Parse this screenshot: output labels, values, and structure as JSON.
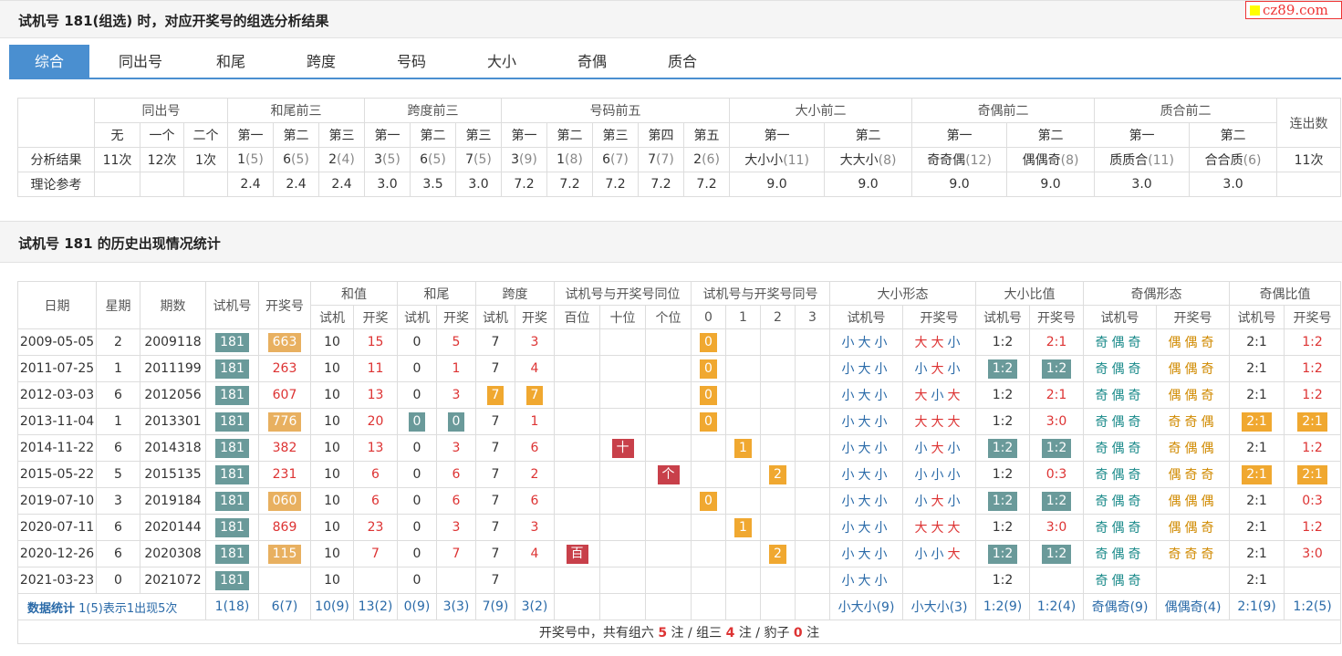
{
  "section1_title": "试机号 181(组选) 时，对应开奖号的组选分析结果",
  "logo_text": "cz89.com",
  "tabs": [
    "综合",
    "同出号",
    "和尾",
    "跨度",
    "号码",
    "大小",
    "奇偶",
    "质合"
  ],
  "t1": {
    "groups": [
      "同出号",
      "和尾前三",
      "跨度前三",
      "号码前五",
      "大小前二",
      "奇偶前二",
      "质合前二",
      "连出数"
    ],
    "subs": [
      "无",
      "一个",
      "二个",
      "第一",
      "第二",
      "第三",
      "第一",
      "第二",
      "第三",
      "第一",
      "第二",
      "第三",
      "第四",
      "第五",
      "第一",
      "第二",
      "第一",
      "第二",
      "第一",
      "第二"
    ],
    "row_analysis_label": "分析结果",
    "row_ref_label": "理论参考",
    "analysis": [
      "11次",
      "12次",
      "1次",
      "1(5)",
      "6(5)",
      "2(4)",
      "3(5)",
      "6(5)",
      "7(5)",
      "3(9)",
      "1(8)",
      "6(7)",
      "7(7)",
      "2(6)",
      "大小小(11)",
      "大大小(8)",
      "奇奇偶(12)",
      "偶偶奇(8)",
      "质质合(11)",
      "合合质(6)",
      "11次"
    ],
    "ref": [
      "",
      "",
      "",
      "2.4",
      "2.4",
      "2.4",
      "3.0",
      "3.5",
      "3.0",
      "7.2",
      "7.2",
      "7.2",
      "7.2",
      "7.2",
      "9.0",
      "9.0",
      "9.0",
      "9.0",
      "3.0",
      "3.0",
      ""
    ]
  },
  "section2_title": "试机号 181 的历史出现情况统计",
  "t2": {
    "h_single": [
      "日期",
      "星期",
      "期数",
      "试机号",
      "开奖号"
    ],
    "h_groups": [
      "和值",
      "和尾",
      "跨度",
      "试机号与开奖号同位",
      "试机号与开奖号同号",
      "大小形态",
      "大小比值",
      "奇偶形态",
      "奇偶比值"
    ],
    "h_subs": [
      "试机",
      "开奖",
      "试机",
      "开奖",
      "试机",
      "开奖",
      "百位",
      "十位",
      "个位",
      "0",
      "1",
      "2",
      "3",
      "试机号",
      "开奖号",
      "试机号",
      "开奖号",
      "试机号",
      "开奖号",
      "试机号",
      "开奖号"
    ],
    "rows": [
      [
        "2009-05-05",
        "2",
        "2009118",
        "181",
        "663",
        "10",
        "15",
        "0",
        "5",
        "7",
        "3",
        "",
        "",
        "",
        "0",
        "",
        "",
        "",
        "小大小",
        "大大小",
        "1:2",
        "2:1",
        "奇偶奇",
        "偶偶奇",
        "2:1",
        "1:2"
      ],
      [
        "2011-07-25",
        "1",
        "2011199",
        "181",
        "263",
        "10",
        "11",
        "0",
        "1",
        "7",
        "4",
        "",
        "",
        "",
        "0",
        "",
        "",
        "",
        "小大小",
        "小大小",
        "1:2",
        "1:2",
        "奇偶奇",
        "偶偶奇",
        "2:1",
        "1:2"
      ],
      [
        "2012-03-03",
        "6",
        "2012056",
        "181",
        "607",
        "10",
        "13",
        "0",
        "3",
        "7",
        "7",
        "",
        "",
        "",
        "0",
        "",
        "",
        "",
        "小大小",
        "大小大",
        "1:2",
        "2:1",
        "奇偶奇",
        "偶偶奇",
        "2:1",
        "1:2"
      ],
      [
        "2013-11-04",
        "1",
        "2013301",
        "181",
        "776",
        "10",
        "20",
        "0",
        "0",
        "7",
        "1",
        "",
        "",
        "",
        "0",
        "",
        "",
        "",
        "小大小",
        "大大大",
        "1:2",
        "3:0",
        "奇偶奇",
        "奇奇偶",
        "2:1",
        "2:1"
      ],
      [
        "2014-11-22",
        "6",
        "2014318",
        "181",
        "382",
        "10",
        "13",
        "0",
        "3",
        "7",
        "6",
        "",
        "十",
        "",
        "",
        "1",
        "",
        "",
        "小大小",
        "小大小",
        "1:2",
        "1:2",
        "奇偶奇",
        "奇偶偶",
        "2:1",
        "1:2"
      ],
      [
        "2015-05-22",
        "5",
        "2015135",
        "181",
        "231",
        "10",
        "6",
        "0",
        "6",
        "7",
        "2",
        "",
        "",
        "个",
        "",
        "",
        "2",
        "",
        "小大小",
        "小小小",
        "1:2",
        "0:3",
        "奇偶奇",
        "偶奇奇",
        "2:1",
        "2:1"
      ],
      [
        "2019-07-10",
        "3",
        "2019184",
        "181",
        "060",
        "10",
        "6",
        "0",
        "6",
        "7",
        "6",
        "",
        "",
        "",
        "0",
        "",
        "",
        "",
        "小大小",
        "小大小",
        "1:2",
        "1:2",
        "奇偶奇",
        "偶偶偶",
        "2:1",
        "0:3"
      ],
      [
        "2020-07-11",
        "6",
        "2020144",
        "181",
        "869",
        "10",
        "23",
        "0",
        "3",
        "7",
        "3",
        "",
        "",
        "",
        "",
        "1",
        "",
        "",
        "小大小",
        "大大大",
        "1:2",
        "3:0",
        "奇偶奇",
        "偶偶奇",
        "2:1",
        "1:2"
      ],
      [
        "2020-12-26",
        "6",
        "2020308",
        "181",
        "115",
        "10",
        "7",
        "0",
        "7",
        "7",
        "4",
        "百",
        "",
        "",
        "",
        "",
        "2",
        "",
        "小大小",
        "小小大",
        "1:2",
        "1:2",
        "奇偶奇",
        "奇奇奇",
        "2:1",
        "3:0"
      ],
      [
        "2021-03-23",
        "0",
        "2021072",
        "181",
        "",
        "10",
        "",
        "0",
        "",
        "7",
        "",
        "",
        "",
        "",
        "",
        "",
        "",
        "",
        "小大小",
        "",
        "1:2",
        "",
        "奇偶奇",
        "",
        "2:1",
        ""
      ]
    ],
    "stat_label": "数据统计",
    "stat_note": "1(5)表示1出现5次",
    "stat": [
      "1(18)",
      "6(7)",
      "10(9)",
      "13(2)",
      "0(9)",
      "3(3)",
      "7(9)",
      "3(2)",
      "",
      "",
      "",
      "",
      "",
      "",
      "",
      "小大小(9)",
      "小大小(3)",
      "1:2(9)",
      "1:2(4)",
      "奇偶奇(9)",
      "偶偶奇(4)",
      "2:1(9)",
      "1:2(5)"
    ],
    "footer_prefix": "开奖号中，共有组六",
    "footer_n6": "5",
    "footer_mid1": "注 / 组三",
    "footer_n3": "4",
    "footer_mid2": "注 / 豹子",
    "footer_n0": "0",
    "footer_suffix": "注"
  }
}
